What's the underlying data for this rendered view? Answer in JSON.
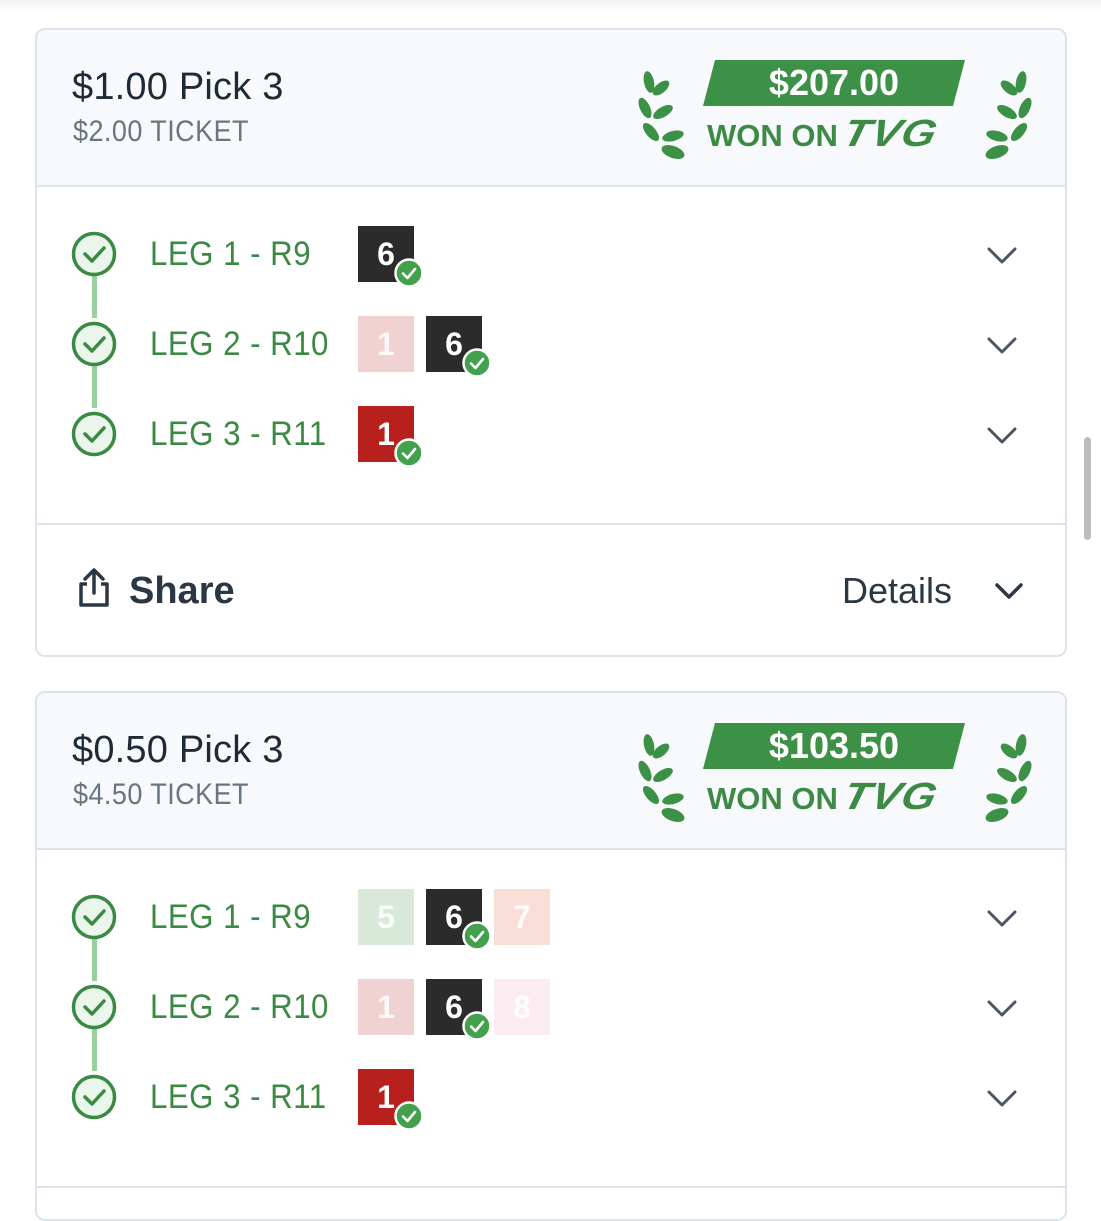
{
  "tickets": [
    {
      "title": "$1.00 Pick 3",
      "subtitle": "$2.00 TICKET",
      "winnings": "$207.00",
      "won_label": "WON ON",
      "brand": "TVG",
      "legs": [
        {
          "label": "LEG 1 - R9",
          "runners": [
            {
              "number": "6",
              "status": "winner"
            }
          ]
        },
        {
          "label": "LEG 2 - R10",
          "runners": [
            {
              "number": "1",
              "status": "lost"
            },
            {
              "number": "6",
              "status": "winner"
            }
          ]
        },
        {
          "label": "LEG 3 - R11",
          "runners": [
            {
              "number": "1",
              "status": "winner"
            }
          ]
        }
      ],
      "footer": {
        "share_label": "Share",
        "details_label": "Details"
      }
    },
    {
      "title": "$0.50 Pick 3",
      "subtitle": "$4.50 TICKET",
      "winnings": "$103.50",
      "won_label": "WON ON",
      "brand": "TVG",
      "legs": [
        {
          "label": "LEG 1 - R9",
          "runners": [
            {
              "number": "5",
              "status": "lost"
            },
            {
              "number": "6",
              "status": "winner"
            },
            {
              "number": "7",
              "status": "lost"
            }
          ]
        },
        {
          "label": "LEG 2 - R10",
          "runners": [
            {
              "number": "1",
              "status": "lost"
            },
            {
              "number": "6",
              "status": "winner"
            },
            {
              "number": "8",
              "status": "lost"
            }
          ]
        },
        {
          "label": "LEG 3 - R11",
          "runners": [
            {
              "number": "1",
              "status": "winner"
            }
          ]
        }
      ]
    }
  ],
  "colors": {
    "win_green": "#3d9146",
    "leg_green": "#3a8a44",
    "runner_1": "#b8201d",
    "runner_5": "#3d9146",
    "runner_6": "#2b2b2b",
    "runner_7": "#e35a3c",
    "runner_8": "#e8a2b3"
  }
}
